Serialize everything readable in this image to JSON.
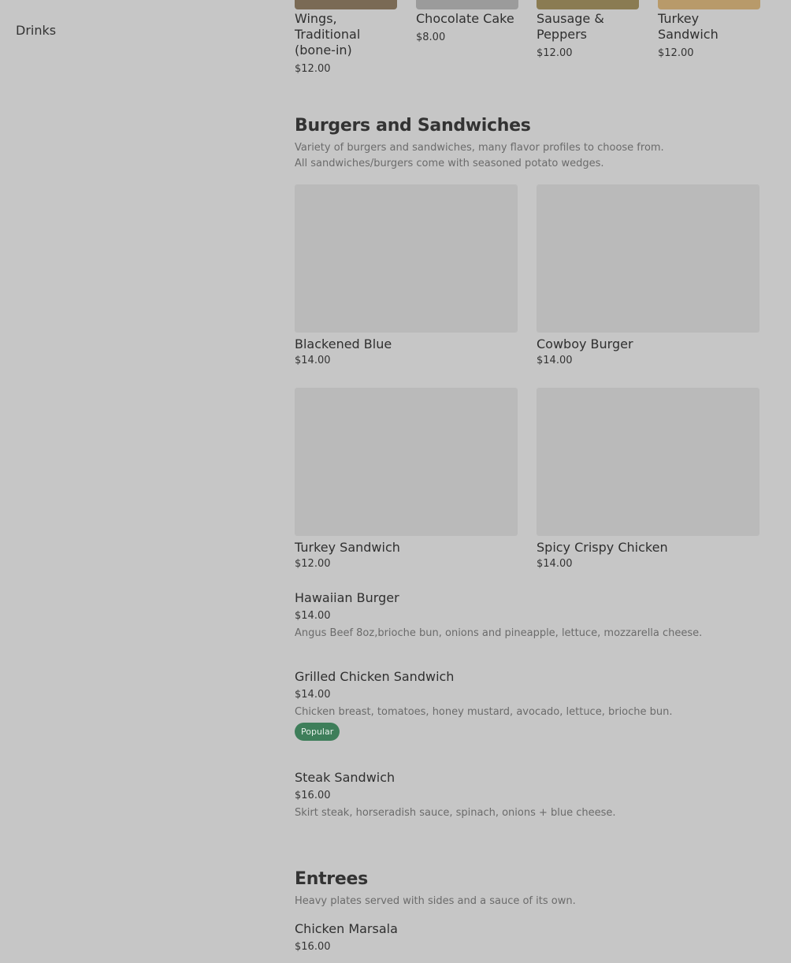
{
  "sidebar": {
    "items": [
      {
        "label": "Drinks"
      }
    ]
  },
  "popular": {
    "items": [
      {
        "name": "Wings, Traditional (bone-in)",
        "price": "$12.00",
        "img_color": "#7a6a55"
      },
      {
        "name": "Chocolate Cake",
        "price": "$8.00",
        "img_color": "#9b9b9b"
      },
      {
        "name": "Sausage & Peppers",
        "price": "$12.00",
        "img_color": "#8a7b52"
      },
      {
        "name": "Turkey Sandwich",
        "price": "$12.00",
        "img_color": "#b89a6a"
      }
    ]
  },
  "burgers": {
    "title": "Burgers and Sandwiches",
    "desc1": "Variety of burgers and sandwiches, many flavor profiles to choose from.",
    "desc2": "All sandwiches/burgers come with seasoned potato wedges.",
    "grid": [
      {
        "name": "Blackened Blue",
        "price": "$14.00"
      },
      {
        "name": "Cowboy Burger",
        "price": "$14.00"
      },
      {
        "name": "Turkey Sandwich",
        "price": "$12.00"
      },
      {
        "name": "Spicy Crispy Chicken",
        "price": "$14.00"
      }
    ],
    "list": [
      {
        "name": "Hawaiian Burger",
        "price": "$14.00",
        "desc": "Angus Beef 8oz,brioche bun, onions and pineapple, lettuce, mozzarella cheese."
      },
      {
        "name": "Grilled Chicken Sandwich",
        "price": "$14.00",
        "desc": "Chicken breast, tomatoes, honey mustard, avocado, lettuce, brioche bun.",
        "badge": "Popular"
      },
      {
        "name": "Steak Sandwich",
        "price": "$16.00",
        "desc": "Skirt steak, horseradish sauce, spinach, onions + blue cheese."
      }
    ]
  },
  "entrees": {
    "title": "Entrees",
    "desc": "Heavy plates served with sides and a sauce of its own.",
    "list": [
      {
        "name": "Chicken Marsala",
        "price": "$16.00"
      }
    ]
  },
  "colors": {
    "background": "#c6c6c6",
    "badge": "#3e7e5a",
    "image_placeholder": "#bababa"
  }
}
